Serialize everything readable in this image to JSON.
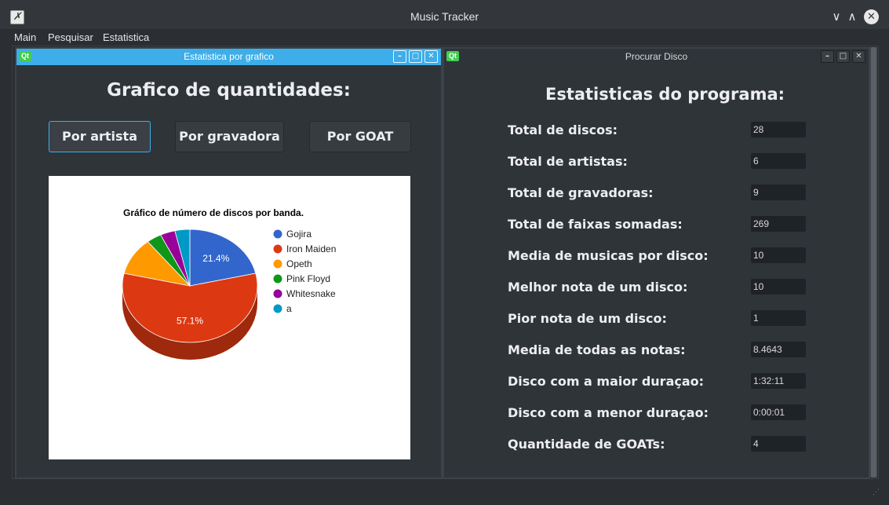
{
  "window": {
    "title": "Music Tracker"
  },
  "menu": [
    "Main",
    "Pesquisar",
    "Estatistica"
  ],
  "left_window": {
    "title": "Estatistica por grafico",
    "qt_badge": "Qt",
    "heading": "Grafico de quantidades:",
    "buttons": [
      "Por artista",
      "Por gravadora",
      "Por GOAT"
    ]
  },
  "right_window": {
    "title": "Procurar Disco",
    "qt_badge": "Qt",
    "heading": "Estatisticas do programa:",
    "stats": [
      {
        "label": "Total de discos:",
        "value": "28"
      },
      {
        "label": "Total de artistas:",
        "value": "6"
      },
      {
        "label": "Total de gravadoras:",
        "value": "9"
      },
      {
        "label": "Total de faixas somadas:",
        "value": "269"
      },
      {
        "label": "Media de musicas por disco:",
        "value": "10"
      },
      {
        "label": "Melhor nota de um disco:",
        "value": "10"
      },
      {
        "label": "Pior nota de um disco:",
        "value": "1"
      },
      {
        "label": "Media de todas as notas:",
        "value": "8.4643"
      },
      {
        "label": "Disco com a maior duraçao:",
        "value": "1:32:11"
      },
      {
        "label": "Disco com a menor duraçao:",
        "value": "0:00:01"
      },
      {
        "label": "Quantidade de GOATs:",
        "value": "4"
      }
    ]
  },
  "chart_data": {
    "type": "pie",
    "title": "Gráfico de número de discos por banda.",
    "categories": [
      "Gojira",
      "Iron Maiden",
      "Opeth",
      "Pink Floyd",
      "Whitesnake",
      "a"
    ],
    "values": [
      6,
      16,
      3,
      1,
      1,
      1
    ],
    "slice_labels": [
      "21.4%",
      "57.1%",
      "",
      "",
      "",
      ""
    ],
    "colors": [
      "#3366cc",
      "#dc3912",
      "#ff9900",
      "#109618",
      "#990099",
      "#0099c6"
    ],
    "legend": "right",
    "style": "3d"
  }
}
